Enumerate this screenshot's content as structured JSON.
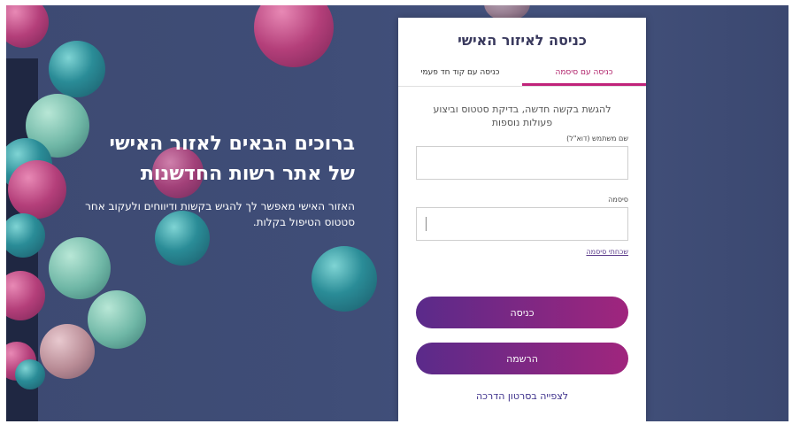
{
  "hero": {
    "title_line1": "ברוכים הבאים לאזור האישי",
    "title_line2": "של אתר רשות החדשנות",
    "description": "האזור האישי מאפשר לך להגיש בקשות ודיווחים ולעקוב אחר סטטוס הטיפול בקלות."
  },
  "login_card": {
    "title": "כניסה לאיזור האישי",
    "tabs": [
      {
        "label": "כניסה עם סיסמה",
        "active": true
      },
      {
        "label": "כניסה עם קוד חד פעמי",
        "active": false
      }
    ],
    "intro": "להגשת בקשה חדשה, בדיקת סטטוס וביצוע פעולות נוספות",
    "username_label": "שם משתמש (דוא\"ל)",
    "username_value": "",
    "password_label": "סיסמה",
    "password_value": "",
    "forgot_password": "שכחתי סיסמה",
    "login_button": "כניסה",
    "register_button": "הרשמה",
    "video_link": "לצפייה בסרטון הדרכה"
  },
  "colors": {
    "background": "#3f4d77",
    "accent_pink": "#c0237a",
    "button_gradient_start": "#5a2a8a",
    "button_gradient_end": "#a0257d"
  }
}
